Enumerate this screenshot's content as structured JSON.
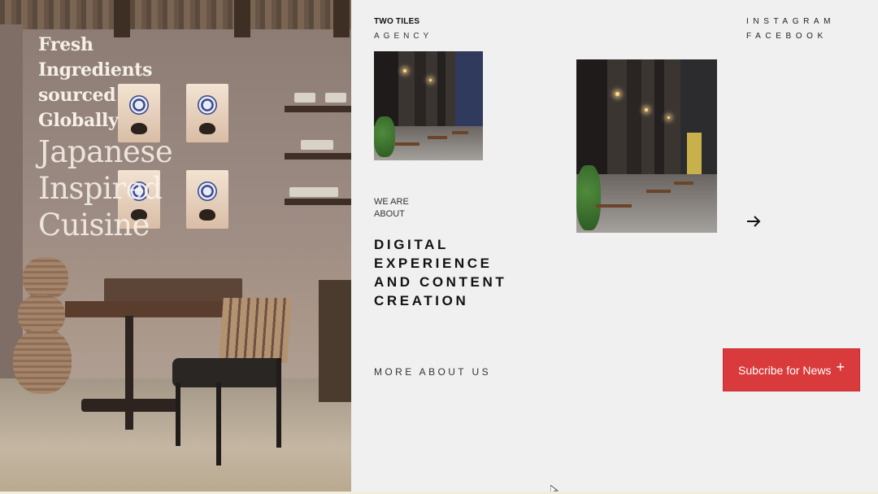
{
  "hero": {
    "lines_bold": [
      "Fresh",
      "Ingredients",
      "sourced",
      "Globally"
    ],
    "lines_light": [
      "Japanese",
      "Inspired",
      "Cuisine"
    ]
  },
  "brand": {
    "name": "TWO TILES",
    "sub": "AGENCY"
  },
  "social": {
    "instagram": "INSTAGRAM",
    "facebook": "FACEBOOK"
  },
  "about": {
    "kicker_1": "WE ARE",
    "kicker_2": "ABOUT",
    "headline": [
      "DIGITAL",
      "EXPERIENCE",
      "AND CONTENT",
      "CREATION"
    ],
    "more_link": "MORE ABOUT US"
  },
  "cta": {
    "label": "Subcribe for News",
    "icon": "+"
  },
  "icons": {
    "next": "arrow-right-icon",
    "cursor": "mouse-pointer-icon"
  },
  "colors": {
    "accent": "#d93a3c",
    "panel": "#f1f0f0",
    "text": "#111111"
  }
}
